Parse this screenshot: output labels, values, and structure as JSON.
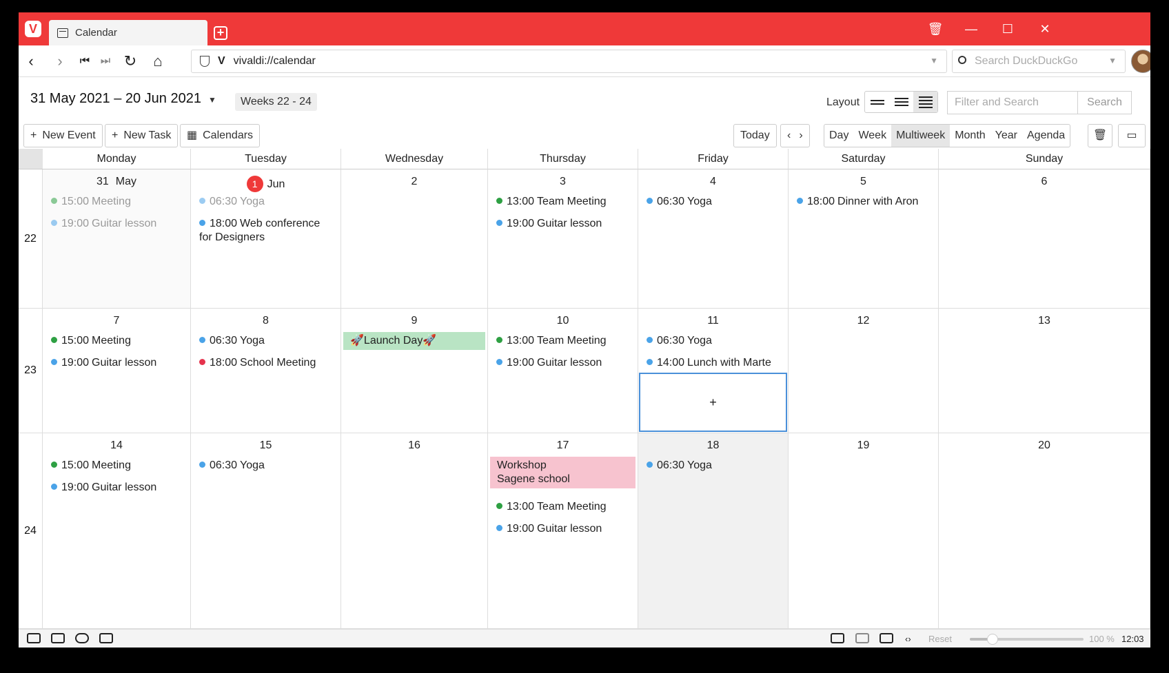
{
  "browser": {
    "tab_title": "Calendar",
    "url": "vivaldi://calendar",
    "search_placeholder": "Search DuckDuckGo"
  },
  "calendar": {
    "range": "31 May 2021 – 20 Jun 2021",
    "weeks_pill": "Weeks 22 - 24",
    "layout_label": "Layout",
    "filter_placeholder": "Filter and Search",
    "search_label": "Search",
    "new_event": "New Event",
    "new_task": "New Task",
    "calendars": "Calendars",
    "today": "Today",
    "views": [
      "Day",
      "Week",
      "Multiweek",
      "Month",
      "Year",
      "Agenda"
    ],
    "active_view": "Multiweek",
    "weekdays": [
      "Monday",
      "Tuesday",
      "Wednesday",
      "Thursday",
      "Friday",
      "Saturday",
      "Sunday"
    ],
    "weeks": [
      {
        "number": "22",
        "days": [
          {
            "label": "31",
            "month": "May",
            "events": [
              {
                "time": "15:00",
                "title": "Meeting",
                "color": "#2ea043",
                "past": true
              },
              {
                "time": "19:00",
                "title": "Guitar lesson",
                "color": "#4aa3e8",
                "past": true
              }
            ]
          },
          {
            "label": "1",
            "month": "Jun",
            "today": true,
            "events": [
              {
                "time": "06:30",
                "title": "Yoga",
                "color": "#4aa3e8",
                "past": true
              },
              {
                "time": "18:00",
                "title": "Web conference for Designers",
                "color": "#4aa3e8"
              }
            ]
          },
          {
            "label": "2",
            "events": []
          },
          {
            "label": "3",
            "events": [
              {
                "time": "13:00",
                "title": "Team Meeting",
                "color": "#2ea043"
              },
              {
                "time": "19:00",
                "title": "Guitar lesson",
                "color": "#4aa3e8"
              }
            ]
          },
          {
            "label": "4",
            "events": [
              {
                "time": "06:30",
                "title": "Yoga",
                "color": "#4aa3e8"
              }
            ]
          },
          {
            "label": "5",
            "events": [
              {
                "time": "18:00",
                "title": "Dinner with Aron",
                "color": "#4aa3e8"
              }
            ]
          },
          {
            "label": "6",
            "events": []
          }
        ]
      },
      {
        "number": "23",
        "days": [
          {
            "label": "7",
            "events": [
              {
                "time": "15:00",
                "title": "Meeting",
                "color": "#2ea043"
              },
              {
                "time": "19:00",
                "title": "Guitar lesson",
                "color": "#4aa3e8"
              }
            ]
          },
          {
            "label": "8",
            "events": [
              {
                "time": "06:30",
                "title": "Yoga",
                "color": "#4aa3e8"
              },
              {
                "time": "18:00",
                "title": "School Meeting",
                "color": "#e5334d"
              }
            ]
          },
          {
            "label": "9",
            "bar": {
              "title": "🚀Launch Day🚀",
              "bg": "#b9e4c4"
            },
            "events": []
          },
          {
            "label": "10",
            "events": [
              {
                "time": "13:00",
                "title": "Team Meeting",
                "color": "#2ea043"
              },
              {
                "time": "19:00",
                "title": "Guitar lesson",
                "color": "#4aa3e8"
              }
            ]
          },
          {
            "label": "11",
            "add_slot": "+",
            "events": [
              {
                "time": "06:30",
                "title": "Yoga",
                "color": "#4aa3e8"
              },
              {
                "time": "14:00",
                "title": "Lunch with Marte",
                "color": "#4aa3e8"
              }
            ]
          },
          {
            "label": "12",
            "events": []
          },
          {
            "label": "13",
            "events": []
          }
        ]
      },
      {
        "number": "24",
        "days": [
          {
            "label": "14",
            "events": [
              {
                "time": "15:00",
                "title": "Meeting",
                "color": "#2ea043"
              },
              {
                "time": "19:00",
                "title": "Guitar lesson",
                "color": "#4aa3e8"
              }
            ]
          },
          {
            "label": "15",
            "events": [
              {
                "time": "06:30",
                "title": "Yoga",
                "color": "#4aa3e8"
              }
            ]
          },
          {
            "label": "16",
            "events": []
          },
          {
            "label": "17",
            "bar": {
              "title": "Workshop",
              "subtitle": "Sagene school",
              "bg": "#f7c3cf"
            },
            "events": [
              {
                "time": "13:00",
                "title": "Team Meeting",
                "color": "#2ea043"
              },
              {
                "time": "19:00",
                "title": "Guitar lesson",
                "color": "#4aa3e8"
              }
            ]
          },
          {
            "label": "18",
            "shade": true,
            "events": [
              {
                "time": "06:30",
                "title": "Yoga",
                "color": "#4aa3e8"
              }
            ]
          },
          {
            "label": "19",
            "events": []
          },
          {
            "label": "20",
            "events": []
          }
        ]
      }
    ]
  },
  "statusbar": {
    "reset": "Reset",
    "zoom": "100 %",
    "zoom_level": 0.2,
    "clock": "12:03"
  },
  "colors": {
    "brand": "#ef3939",
    "today_badge": "#ef3939",
    "selection": "#4a90d9"
  }
}
